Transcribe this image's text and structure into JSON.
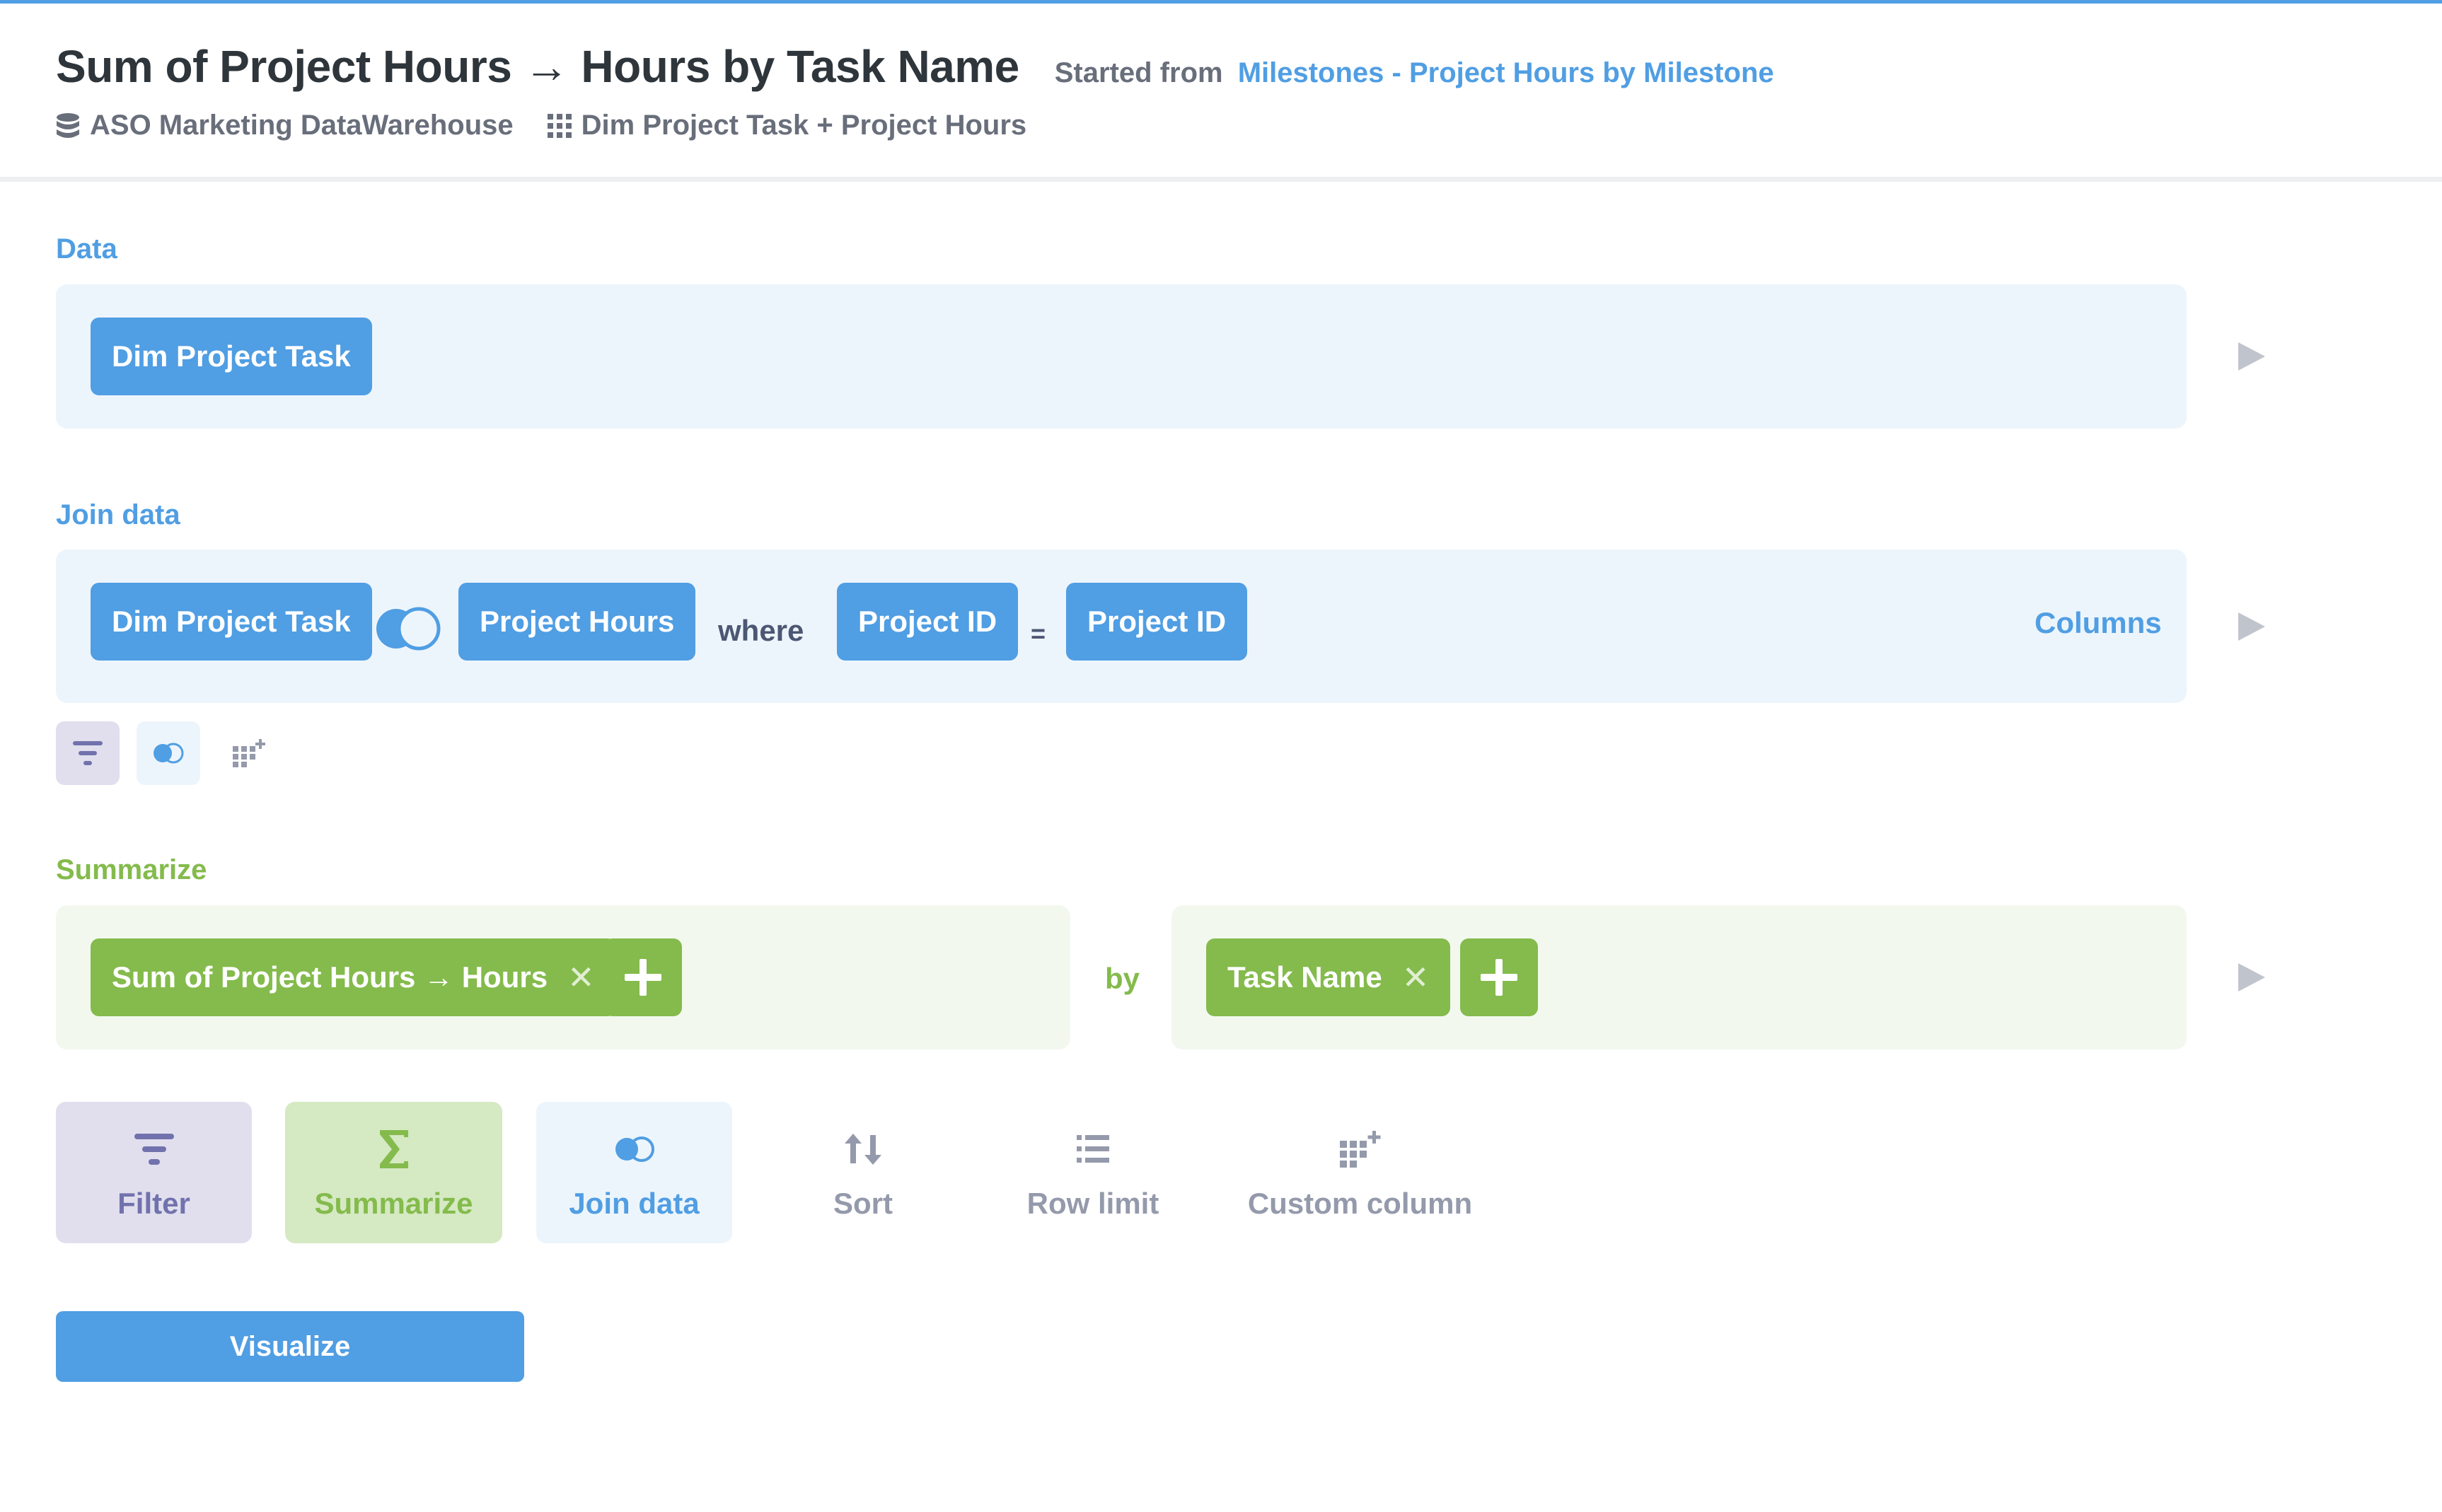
{
  "header": {
    "title": "Sum of Project Hours → Hours by Task Name",
    "started_prefix": "Started from",
    "started_link": "Milestones - Project Hours by Milestone",
    "database": "ASO Marketing DataWarehouse",
    "table": "Dim Project Task + Project Hours"
  },
  "data_step": {
    "label": "Data",
    "source": "Dim Project Task"
  },
  "join_step": {
    "label": "Join data",
    "left_table": "Dim Project Task",
    "right_table": "Project Hours",
    "where": "where",
    "left_column": "Project ID",
    "operator": "=",
    "right_column": "Project ID",
    "columns_link": "Columns"
  },
  "summarize_step": {
    "label": "Summarize",
    "metric": "Sum of Project Hours → Hours",
    "by": "by",
    "breakout": "Task Name"
  },
  "actions": {
    "filter": "Filter",
    "summarize": "Summarize",
    "join": "Join data",
    "sort": "Sort",
    "row_limit": "Row limit",
    "custom_column": "Custom column"
  },
  "visualize_label": "Visualize",
  "colors": {
    "brand": "#509ee3",
    "summarize": "#84bb4c",
    "filter": "#7172ad",
    "text": "#2e353b",
    "muted": "#949aab"
  }
}
